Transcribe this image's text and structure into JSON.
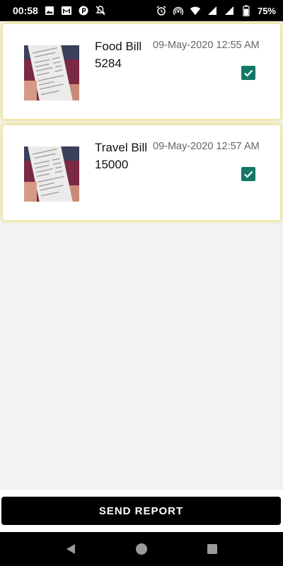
{
  "status_bar": {
    "time": "00:58",
    "left_icons": [
      "image-icon",
      "gmail-icon",
      "paytm-icon",
      "notifications-off-icon"
    ],
    "right_icons": [
      "alarm-icon",
      "hotspot-icon",
      "wifi-icon",
      "signal-icon",
      "signal-icon",
      "battery-icon"
    ],
    "battery_percent": "75%"
  },
  "bills": [
    {
      "title": "Food Bill",
      "amount": "5284",
      "datetime": "09-May-2020 12:55 AM",
      "checked": true,
      "thumbnail": "receipt-photo"
    },
    {
      "title": "Travel Bill",
      "amount": "15000",
      "datetime": "09-May-2020 12:57 AM",
      "checked": true,
      "thumbnail": "receipt-photo"
    }
  ],
  "send_button": {
    "label": "SEND REPORT"
  },
  "nav": {
    "buttons": [
      "back-icon",
      "home-icon",
      "recents-icon"
    ]
  },
  "colors": {
    "checkbox": "#147868",
    "card_glow": "#ebdc5a",
    "button_bg": "#000000"
  }
}
